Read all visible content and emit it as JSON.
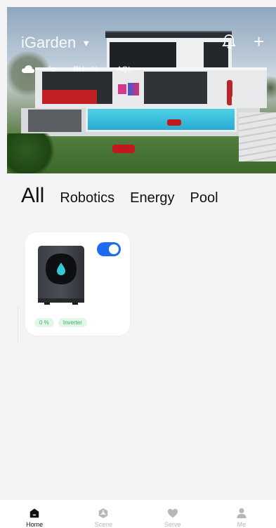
{
  "header": {
    "home_name": "iGarden",
    "weather_temp": "-- °c",
    "weather_rh": "RH --%",
    "weather_aqi": "AQI: --"
  },
  "tabs": [
    {
      "label": "All",
      "active": true
    },
    {
      "label": "Robotics",
      "active": false
    },
    {
      "label": "Energy",
      "active": false
    },
    {
      "label": "Pool",
      "active": false
    }
  ],
  "devices": [
    {
      "power_on": true,
      "tags": [
        "0 %",
        "Inverter"
      ]
    }
  ],
  "nav": [
    {
      "label": "Home",
      "icon": "home-icon",
      "active": true
    },
    {
      "label": "Scene",
      "icon": "scene-icon",
      "active": false
    },
    {
      "label": "Serve",
      "icon": "heart-icon",
      "active": false
    },
    {
      "label": "Me",
      "icon": "person-icon",
      "active": false
    }
  ],
  "colors": {
    "accent": "#1e6bf0",
    "tag_bg": "#e2f6e9",
    "tag_text": "#3cb15f",
    "page_bg": "#f4f4f6"
  }
}
